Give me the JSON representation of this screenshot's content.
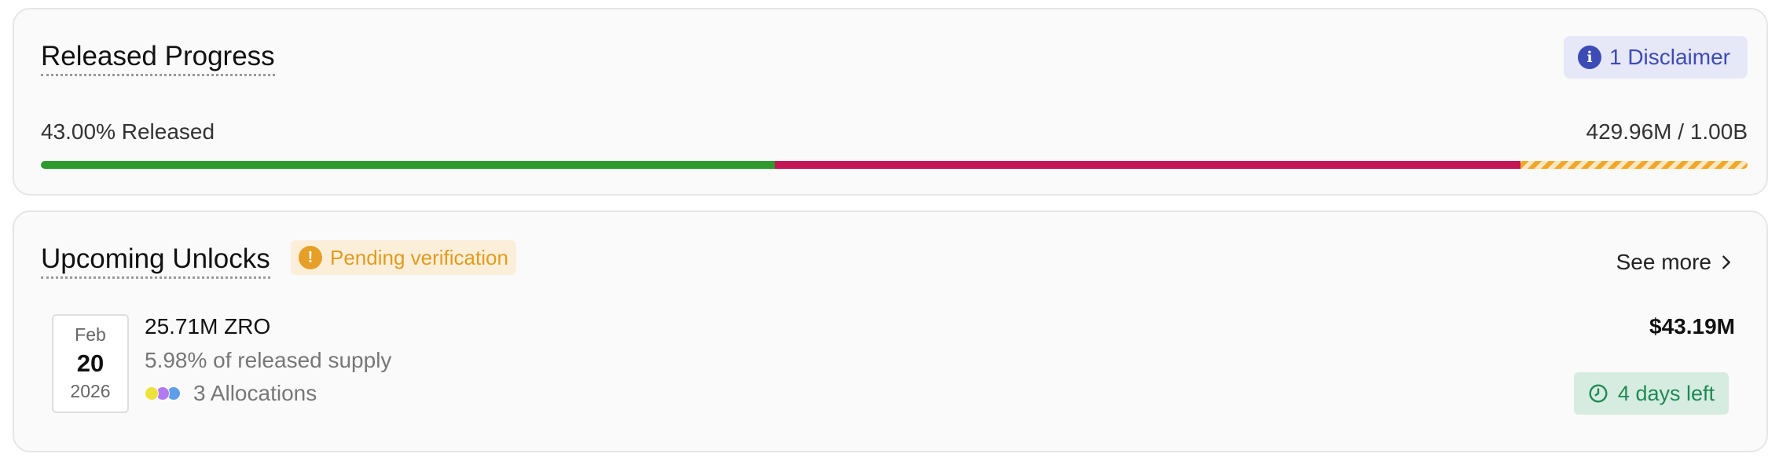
{
  "released_progress": {
    "title": "Released Progress",
    "disclaimer_label": "1 Disclaimer",
    "percent_label": "43.00% Released",
    "amount_label": "429.96M / 1.00B",
    "progress": {
      "released_pct": 43.0,
      "second_segment_pct": 43.7
    },
    "colors": {
      "released": "#2e9a2e",
      "second_segment": "#c41654",
      "remaining_stripes": "#f2a72a"
    }
  },
  "upcoming_unlocks": {
    "title": "Upcoming Unlocks",
    "pending_label": "Pending verification",
    "see_more_label": "See more",
    "items": [
      {
        "month": "Feb",
        "day": "20",
        "year": "2026",
        "amount": "25.71M ZRO",
        "share": "5.98% of released supply",
        "allocations_label": "3 Allocations",
        "allocation_colors": [
          "#ece23a",
          "#b27af0",
          "#5f9ee8"
        ],
        "value": "$43.19M",
        "days_left": "4 days left"
      }
    ]
  }
}
